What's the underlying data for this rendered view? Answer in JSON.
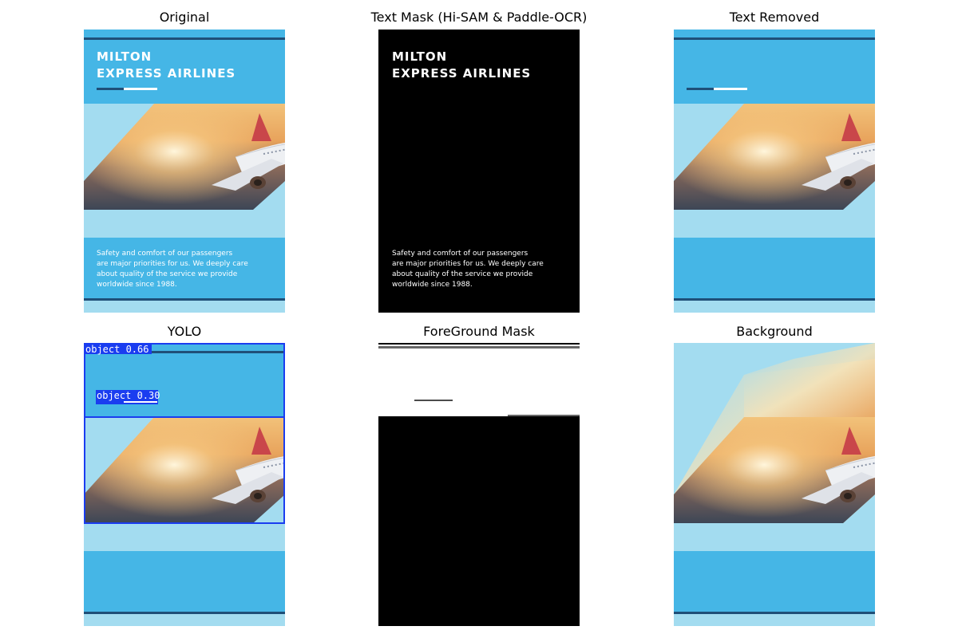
{
  "titles": {
    "original": "Original",
    "text_mask": "Text Mask (Hi-SAM & Paddle-OCR)",
    "text_removed": "Text Removed",
    "yolo": "YOLO",
    "foreground_mask": "ForeGround Mask",
    "background": "Background"
  },
  "poster": {
    "brand_line1": "MILTON",
    "brand_line2": "EXPRESS AIRLINES",
    "body_lines": [
      "Safety and comfort of our passengers",
      "are major priorities for us. We deeply care",
      "about quality of the service we provide",
      "worldwide since 1988."
    ]
  },
  "yolo": {
    "detections": [
      {
        "label": "object 0.66"
      },
      {
        "label": "object 0.30"
      }
    ]
  },
  "colors": {
    "poster_blue": "#45b6e6",
    "poster_light_blue": "#a3dcf0",
    "poster_navy": "#1f4f78",
    "yolo_box": "#1a3df0",
    "mask_black": "#000000",
    "mask_white": "#ffffff"
  }
}
